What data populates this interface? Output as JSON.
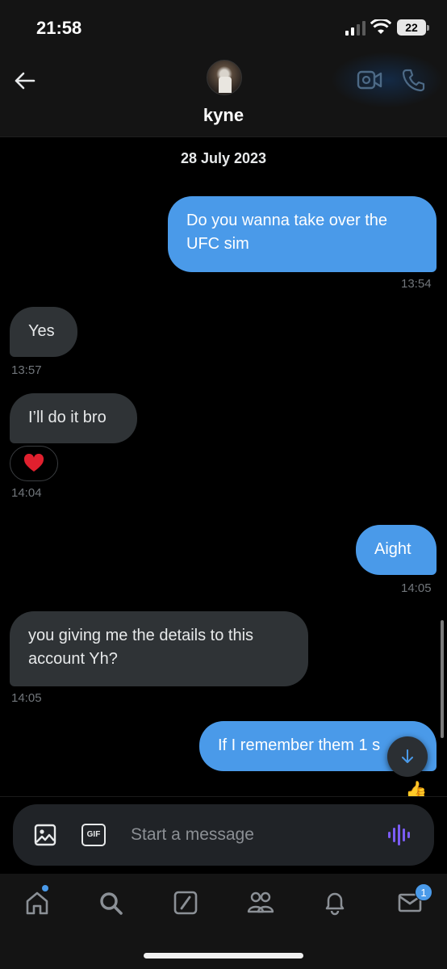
{
  "status_bar": {
    "time": "21:58",
    "battery": "22"
  },
  "header": {
    "contact_name": "kyne",
    "back_icon": "arrow-left-icon",
    "video_icon": "video-camera-icon",
    "call_icon": "phone-icon"
  },
  "conversation": {
    "date": "28 July 2023",
    "messages": [
      {
        "direction": "sent",
        "text": "Do you wanna take over the UFC sim",
        "time": "13:54"
      },
      {
        "direction": "received",
        "text": "Yes",
        "time": "13:57"
      },
      {
        "direction": "received",
        "text": "I’ll do it bro",
        "reaction": "❤️",
        "time": "14:04"
      },
      {
        "direction": "sent",
        "text": "Aight",
        "time": "14:05"
      },
      {
        "direction": "received",
        "text": "you giving me the details to this account Yh?",
        "time": "14:05"
      },
      {
        "direction": "sent",
        "text": "If I remember them 1 s",
        "reaction": "👍"
      }
    ]
  },
  "composer": {
    "placeholder": "Start a message",
    "gif_label": "GIF"
  },
  "tabbar": {
    "items": [
      "home",
      "search",
      "grok",
      "communities",
      "notifications",
      "messages"
    ],
    "messages_badge": "1"
  },
  "colors": {
    "accent": "#4a9ae9",
    "received_bubble": "#2f3336",
    "background": "#000000",
    "voice_icon": "#7b5cf5"
  }
}
